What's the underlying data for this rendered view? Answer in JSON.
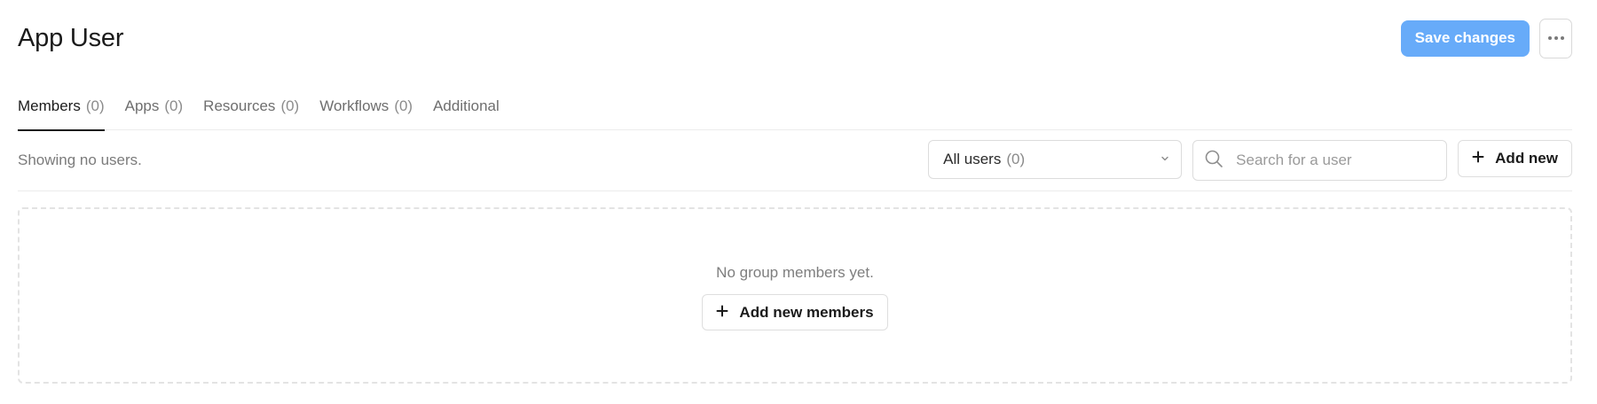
{
  "header": {
    "title": "App User",
    "save_label": "Save changes",
    "more_icon": "more-horizontal-icon"
  },
  "tabs": [
    {
      "label": "Members",
      "count": "(0)",
      "active": true
    },
    {
      "label": "Apps",
      "count": "(0)",
      "active": false
    },
    {
      "label": "Resources",
      "count": "(0)",
      "active": false
    },
    {
      "label": "Workflows",
      "count": "(0)",
      "active": false
    },
    {
      "label": "Additional",
      "count": "",
      "active": false
    }
  ],
  "toolbar": {
    "status_text": "Showing no users.",
    "filter": {
      "label": "All users",
      "count": "(0)"
    },
    "search": {
      "placeholder": "Search for a user",
      "value": ""
    },
    "add_label": "Add new"
  },
  "empty_state": {
    "message": "No group members yet.",
    "button_label": "Add new members"
  },
  "colors": {
    "primary": "#67abf9",
    "text": "#1b1b1b",
    "muted": "#7b7b7b",
    "border": "#dcdcdc"
  }
}
